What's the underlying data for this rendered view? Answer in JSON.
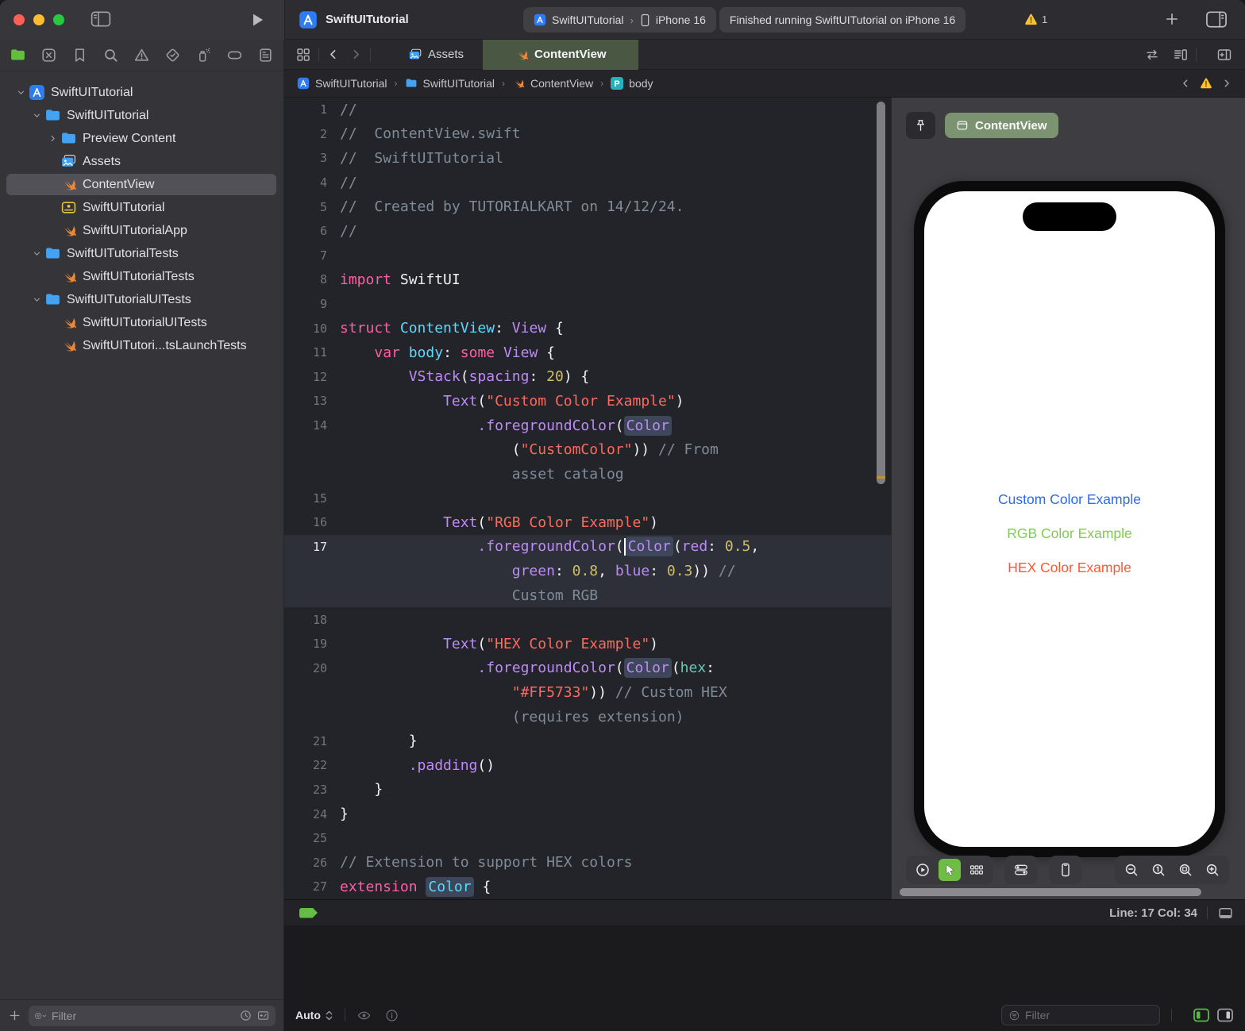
{
  "titlebar": {
    "project": "SwiftUITutorial",
    "scheme": "SwiftUITutorial",
    "run_destination": "iPhone 16",
    "status_message": "Finished running SwiftUITutorial on iPhone 16",
    "warning_count": "1"
  },
  "sidebar": {
    "navigator_icons": [
      {
        "icon": "folder-green",
        "name": "project-navigator-icon",
        "active": true
      },
      {
        "icon": "xsquare",
        "name": "source-control-icon"
      },
      {
        "icon": "bookmark",
        "name": "bookmarks-icon"
      },
      {
        "icon": "search",
        "name": "find-icon"
      },
      {
        "icon": "warntri",
        "name": "issues-icon"
      },
      {
        "icon": "testdiamond",
        "name": "tests-icon"
      },
      {
        "icon": "spray",
        "name": "debug-gauge-icon"
      },
      {
        "icon": "capsule",
        "name": "breakpoints-icon"
      },
      {
        "icon": "report",
        "name": "reports-icon"
      }
    ],
    "tree": [
      {
        "label": "SwiftUITutorial",
        "icon": "app",
        "indent": 0,
        "disclosure": "open"
      },
      {
        "label": "SwiftUITutorial",
        "icon": "folder",
        "indent": 1,
        "disclosure": "open"
      },
      {
        "label": "Preview Content",
        "icon": "folder",
        "indent": 2,
        "disclosure": "closed"
      },
      {
        "label": "Assets",
        "icon": "assets",
        "indent": 2
      },
      {
        "label": "ContentView",
        "icon": "swift",
        "indent": 2,
        "selected": true
      },
      {
        "label": "SwiftUITutorial",
        "icon": "entitlements",
        "indent": 2
      },
      {
        "label": "SwiftUITutorialApp",
        "icon": "swift",
        "indent": 2
      },
      {
        "label": "SwiftUITutorialTests",
        "icon": "folder",
        "indent": 1,
        "disclosure": "open"
      },
      {
        "label": "SwiftUITutorialTests",
        "icon": "swift",
        "indent": 2
      },
      {
        "label": "SwiftUITutorialUITests",
        "icon": "folder",
        "indent": 1,
        "disclosure": "open"
      },
      {
        "label": "SwiftUITutorialUITests",
        "icon": "swift",
        "indent": 2
      },
      {
        "label": "SwiftUITutori...tsLaunchTests",
        "icon": "swift",
        "indent": 2
      }
    ],
    "filter_placeholder": "Filter"
  },
  "tabbar": {
    "tabs": [
      {
        "label": "Assets",
        "icon": "assets",
        "active": false
      },
      {
        "label": "ContentView",
        "icon": "swift",
        "active": true
      }
    ]
  },
  "breadcrumb": {
    "items": [
      {
        "label": "SwiftUITutorial",
        "icon": "app"
      },
      {
        "label": "SwiftUITutorial",
        "icon": "folder"
      },
      {
        "label": "ContentView",
        "icon": "swift"
      },
      {
        "label": "body",
        "icon": "pbadge"
      }
    ]
  },
  "editor": {
    "status": {
      "line_col": "Line: 17  Col: 34"
    },
    "code_rows": [
      {
        "n": "1",
        "t": [
          [
            "cmt",
            "//"
          ]
        ]
      },
      {
        "n": "2",
        "t": [
          [
            "cmt",
            "//  ContentView.swift"
          ]
        ]
      },
      {
        "n": "3",
        "t": [
          [
            "cmt",
            "//  SwiftUITutorial"
          ]
        ]
      },
      {
        "n": "4",
        "t": [
          [
            "cmt",
            "//"
          ]
        ]
      },
      {
        "n": "5",
        "t": [
          [
            "cmt",
            "//  Created by TUTORIALKART on 14/12/24."
          ]
        ]
      },
      {
        "n": "6",
        "t": [
          [
            "cmt",
            "//"
          ]
        ]
      },
      {
        "n": "7",
        "t": []
      },
      {
        "n": "8",
        "t": [
          [
            "kw",
            "import"
          ],
          [
            "pln",
            " SwiftUI"
          ]
        ]
      },
      {
        "n": "9",
        "t": []
      },
      {
        "n": "10",
        "t": [
          [
            "kw",
            "struct"
          ],
          [
            "pln",
            " "
          ],
          [
            "decl",
            "ContentView"
          ],
          [
            "pln",
            ": "
          ],
          [
            "sys",
            "View"
          ],
          [
            "pln",
            " {"
          ]
        ]
      },
      {
        "n": "11",
        "t": [
          [
            "pln",
            "    "
          ],
          [
            "kw",
            "var"
          ],
          [
            "pln",
            " "
          ],
          [
            "decl",
            "body"
          ],
          [
            "pln",
            ": "
          ],
          [
            "kw",
            "some"
          ],
          [
            "pln",
            " "
          ],
          [
            "sys",
            "View"
          ],
          [
            "pln",
            " {"
          ]
        ]
      },
      {
        "n": "12",
        "t": [
          [
            "pln",
            "        "
          ],
          [
            "sys",
            "VStack"
          ],
          [
            "pln",
            "("
          ],
          [
            "sys",
            "spacing"
          ],
          [
            "pln",
            ": "
          ],
          [
            "num",
            "20"
          ],
          [
            "pln",
            ") {"
          ]
        ]
      },
      {
        "n": "13",
        "t": [
          [
            "pln",
            "            "
          ],
          [
            "sys",
            "Text"
          ],
          [
            "pln",
            "("
          ],
          [
            "str",
            "\"Custom Color Example\""
          ],
          [
            "pln",
            ")"
          ]
        ]
      },
      {
        "n": "14",
        "t": [
          [
            "pln",
            "                "
          ],
          [
            "sys",
            ".foregroundColor"
          ],
          [
            "pln",
            "("
          ],
          [
            "sysb",
            "Color"
          ]
        ]
      },
      {
        "n": "",
        "t": [
          [
            "pln",
            "                    ("
          ],
          [
            "str",
            "\"CustomColor\""
          ],
          [
            "pln",
            ")) "
          ],
          [
            "cmt",
            "// From"
          ]
        ]
      },
      {
        "n": "",
        "t": [
          [
            "pln",
            "                    "
          ],
          [
            "cmt",
            "asset catalog"
          ]
        ]
      },
      {
        "n": "15",
        "t": []
      },
      {
        "n": "16",
        "t": [
          [
            "pln",
            "            "
          ],
          [
            "sys",
            "Text"
          ],
          [
            "pln",
            "("
          ],
          [
            "str",
            "\"RGB Color Example\""
          ],
          [
            "pln",
            ")"
          ]
        ]
      },
      {
        "n": "17",
        "cur": true,
        "t": [
          [
            "pln",
            "                "
          ],
          [
            "sys",
            ".foregroundColor"
          ],
          [
            "pln",
            "("
          ],
          [
            "caret",
            ""
          ],
          [
            "sysb",
            "Color"
          ],
          [
            "pln",
            "("
          ],
          [
            "sys",
            "red"
          ],
          [
            "pln",
            ": "
          ],
          [
            "num",
            "0.5"
          ],
          [
            "pln",
            ","
          ]
        ]
      },
      {
        "n": "",
        "cur": true,
        "t": [
          [
            "pln",
            "                    "
          ],
          [
            "sys",
            "green"
          ],
          [
            "pln",
            ": "
          ],
          [
            "num",
            "0.8"
          ],
          [
            "pln",
            ", "
          ],
          [
            "sys",
            "blue"
          ],
          [
            "pln",
            ": "
          ],
          [
            "num",
            "0.3"
          ],
          [
            "pln",
            ")) "
          ],
          [
            "cmt",
            "//"
          ]
        ]
      },
      {
        "n": "",
        "cur": true,
        "t": [
          [
            "pln",
            "                    "
          ],
          [
            "cmt",
            "Custom RGB"
          ]
        ]
      },
      {
        "n": "18",
        "t": []
      },
      {
        "n": "19",
        "t": [
          [
            "pln",
            "            "
          ],
          [
            "sys",
            "Text"
          ],
          [
            "pln",
            "("
          ],
          [
            "str",
            "\"HEX Color Example\""
          ],
          [
            "pln",
            ")"
          ]
        ]
      },
      {
        "n": "20",
        "t": [
          [
            "pln",
            "                "
          ],
          [
            "sys",
            ".foregroundColor"
          ],
          [
            "pln",
            "("
          ],
          [
            "sysb",
            "Color"
          ],
          [
            "pln",
            "("
          ],
          [
            "proj",
            "hex"
          ],
          [
            "pln",
            ":"
          ]
        ]
      },
      {
        "n": "",
        "t": [
          [
            "pln",
            "                    "
          ],
          [
            "str",
            "\"#FF5733\""
          ],
          [
            "pln",
            ")) "
          ],
          [
            "cmt",
            "// Custom HEX"
          ]
        ]
      },
      {
        "n": "",
        "t": [
          [
            "pln",
            "                    "
          ],
          [
            "cmt",
            "(requires extension)"
          ]
        ]
      },
      {
        "n": "21",
        "t": [
          [
            "pln",
            "        }"
          ]
        ]
      },
      {
        "n": "22",
        "t": [
          [
            "pln",
            "        "
          ],
          [
            "sys",
            ".padding"
          ],
          [
            "pln",
            "()"
          ]
        ]
      },
      {
        "n": "23",
        "t": [
          [
            "pln",
            "    }"
          ]
        ]
      },
      {
        "n": "24",
        "t": [
          [
            "pln",
            "}"
          ]
        ]
      },
      {
        "n": "25",
        "t": []
      },
      {
        "n": "26",
        "t": [
          [
            "cmt",
            "// Extension to support HEX colors"
          ]
        ]
      },
      {
        "n": "27",
        "t": [
          [
            "kw",
            "extension"
          ],
          [
            "pln",
            " "
          ],
          [
            "declb",
            "Color"
          ],
          [
            "pln",
            " {"
          ]
        ]
      }
    ],
    "syntax_colors": {
      "comment": "#7F8C98",
      "keyword": "#FC5FA3",
      "string": "#FC6A5D",
      "number": "#D0BF69",
      "system_symbol": "#BD8BF5",
      "declaration": "#5DD8FF",
      "project_symbol": "#67C8B5",
      "plain": "#F2F2F4"
    }
  },
  "canvas": {
    "pill_label": "ContentView",
    "preview_texts": [
      {
        "text": "Custom Color Example",
        "color": "#2C6BE5"
      },
      {
        "text": "RGB Color Example",
        "color": "#7FCC4D"
      },
      {
        "text": "HEX Color Example",
        "color": "#FF5733"
      }
    ],
    "toolbar_groups": [
      [
        {
          "icon": "playcircle",
          "name": "live-preview-icon"
        },
        {
          "icon": "cursor",
          "name": "selectable-mode-icon",
          "active": true
        },
        {
          "icon": "variants",
          "name": "variants-icon"
        }
      ],
      [
        {
          "icon": "toggles",
          "name": "device-settings-icon"
        }
      ],
      [
        {
          "icon": "phone",
          "name": "device-icon"
        }
      ]
    ],
    "zoom_icons": [
      {
        "icon": "zoomout",
        "name": "zoom-out-icon"
      },
      {
        "icon": "zoom1",
        "name": "zoom-100-icon"
      },
      {
        "icon": "zoomfit",
        "name": "zoom-fit-icon"
      },
      {
        "icon": "zoomin",
        "name": "zoom-in-icon"
      }
    ]
  },
  "bottombar": {
    "auto_label": "Auto",
    "debug_filter_placeholder": "Filter"
  },
  "colors": {
    "active_tab_green": "#4A5843",
    "preview_pill_green": "#7B9370",
    "warning_yellow": "#FFC12E",
    "run_tag_green": "#66BD45",
    "selection_box": "#3D4759"
  }
}
